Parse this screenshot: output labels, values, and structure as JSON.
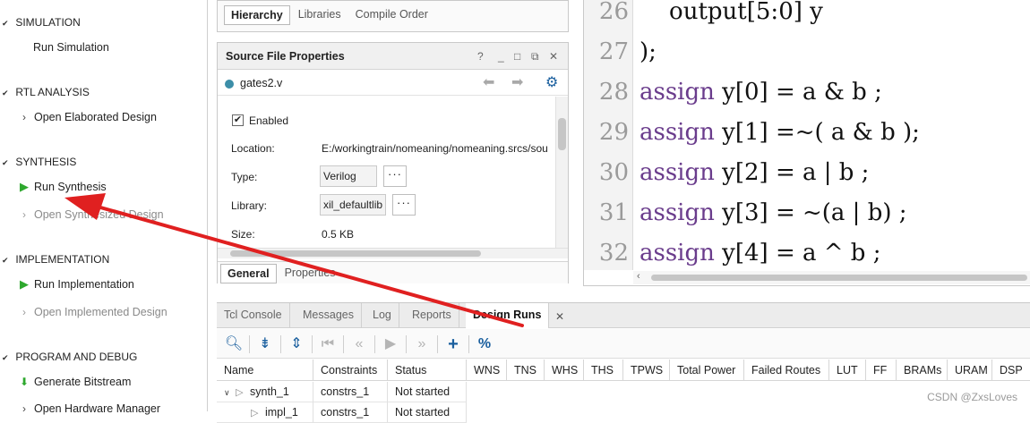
{
  "flow_navigator": {
    "sections": [
      {
        "title": "SIMULATION",
        "items": [
          {
            "label": "Run Simulation",
            "icon": "none",
            "dim": false
          }
        ]
      },
      {
        "title": "RTL ANALYSIS",
        "items": [
          {
            "label": "Open Elaborated Design",
            "icon": "chevron-right-icon",
            "dim": false
          }
        ]
      },
      {
        "title": "SYNTHESIS",
        "items": [
          {
            "label": "Run Synthesis",
            "icon": "play-icon",
            "dim": false
          },
          {
            "label": "Open Synthesized Design",
            "icon": "chevron-right-icon",
            "dim": true
          }
        ]
      },
      {
        "title": "IMPLEMENTATION",
        "items": [
          {
            "label": "Run Implementation",
            "icon": "play-icon",
            "dim": false
          },
          {
            "label": "Open Implemented Design",
            "icon": "chevron-right-icon",
            "dim": true
          }
        ]
      },
      {
        "title": "PROGRAM AND DEBUG",
        "items": [
          {
            "label": "Generate Bitstream",
            "icon": "bitstream-icon",
            "dim": false
          },
          {
            "label": "Open Hardware Manager",
            "icon": "chevron-right-icon",
            "dim": false
          }
        ]
      }
    ]
  },
  "sources": {
    "tabs": [
      "Hierarchy",
      "Libraries",
      "Compile Order"
    ],
    "active_tab": "Hierarchy"
  },
  "properties": {
    "title": "Source File Properties",
    "window_icons": [
      "?",
      "_",
      "□",
      "⧉",
      "✕"
    ],
    "file_name": "gates2.v",
    "enabled_label": "Enabled",
    "enabled_checked": true,
    "location_label": "Location:",
    "location_value": "E:/workingtrain/nomeaning/nomeaning.srcs/sou",
    "type_label": "Type:",
    "type_value": "Verilog",
    "library_label": "Library:",
    "library_value": "xil_defaultlib",
    "size_label": "Size:",
    "size_value": "0.5 KB",
    "ellipsis": "···",
    "bottom_tabs": [
      "General",
      "Properties"
    ],
    "active_bottom_tab": "General"
  },
  "editor": {
    "lines": [
      {
        "num": "26",
        "kw": "",
        "text": "    output[5:0] y"
      },
      {
        "num": "27",
        "kw": "",
        "text": ");"
      },
      {
        "num": "28",
        "kw": "assign",
        "text": " y[0] = a & b ;"
      },
      {
        "num": "29",
        "kw": "assign",
        "text": " y[1] =~( a & b );"
      },
      {
        "num": "30",
        "kw": "assign",
        "text": " y[2] = a | b ;"
      },
      {
        "num": "31",
        "kw": "assign",
        "text": " y[3] = ~(a | b) ;"
      },
      {
        "num": "32",
        "kw": "assign",
        "text": " y[4] = a ^ b ;"
      }
    ],
    "keyword_color": "#6a3c8c"
  },
  "tool_window": {
    "tabs": [
      "Tcl Console",
      "Messages",
      "Log",
      "Reports",
      "Design Runs"
    ],
    "active_tab": "Design Runs",
    "close": "✕",
    "toolbar_icons": [
      "search-icon",
      "collapse-all-icon",
      "expand-all-icon",
      "first-icon",
      "rewind-icon",
      "play-icon",
      "fast-forward-icon",
      "add-icon",
      "percent-icon"
    ],
    "columns": [
      "Name",
      "Constraints",
      "Status",
      "WNS",
      "TNS",
      "WHS",
      "THS",
      "TPWS",
      "Total Power",
      "Failed Routes",
      "LUT",
      "FF",
      "BRAMs",
      "URAM",
      "DSP"
    ],
    "rows": [
      {
        "name": "synth_1",
        "constraints": "constrs_1",
        "status": "Not started"
      },
      {
        "name": "impl_1",
        "constraints": "constrs_1",
        "status": "Not started"
      }
    ]
  },
  "watermark": "CSDN @ZxsLoves",
  "colors": {
    "accent_green": "#2ea82e",
    "annotation_red": "#e02020",
    "toolbar_blue": "#1a5f9e"
  }
}
